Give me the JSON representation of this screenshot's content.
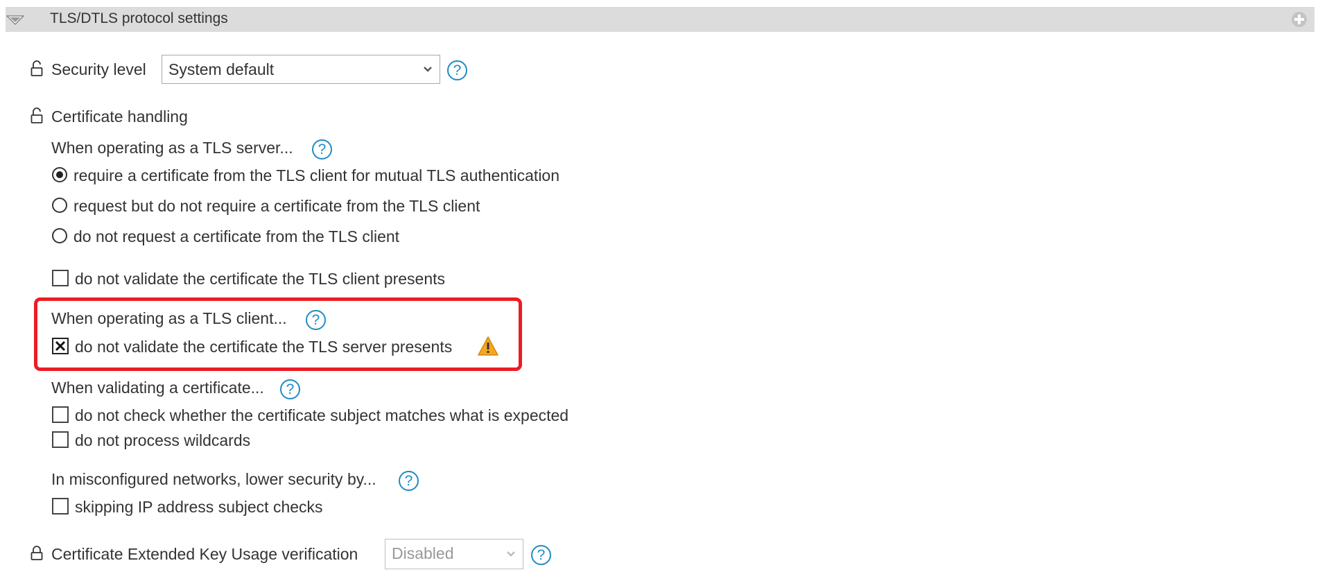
{
  "section": {
    "title": "TLS/DTLS protocol settings"
  },
  "security_level": {
    "label": "Security level",
    "value": "System default"
  },
  "certificate_handling": {
    "label": "Certificate handling",
    "server_heading": "When operating as a TLS server...",
    "server_options": [
      "require a certificate from the TLS client for mutual TLS authentication",
      "request but do not require a certificate from the TLS client",
      "do not request a certificate from the TLS client"
    ],
    "server_selected_index": 0,
    "no_validate_client": {
      "label": "do not validate the certificate the TLS client presents",
      "checked": false
    },
    "client_heading": "When operating as a TLS client...",
    "no_validate_server": {
      "label": "do not validate the certificate the TLS server presents",
      "checked": true
    },
    "validate_heading": "When validating a certificate...",
    "no_subject_check": {
      "label": "do not check whether the certificate subject matches what is expected",
      "checked": false
    },
    "no_wildcards": {
      "label": "do not process wildcards",
      "checked": false
    },
    "misconfig_heading": "In misconfigured networks, lower security by...",
    "skip_ip": {
      "label": "skipping IP address subject checks",
      "checked": false
    }
  },
  "eku": {
    "label": "Certificate Extended Key Usage verification",
    "value": "Disabled"
  },
  "colors": {
    "help": "#1f8cc2",
    "highlight": "#ec1c24",
    "warning": "#f5a623",
    "header_bg": "#dcdcdc"
  },
  "icons": {
    "collapse": "triangle-down-icon",
    "add": "plus-circle-icon",
    "unlocked": "unlocked-padlock-icon",
    "locked": "locked-padlock-icon",
    "help": "question-circle-icon",
    "warning": "warning-triangle-icon",
    "dropdown": "chevron-down-icon"
  }
}
